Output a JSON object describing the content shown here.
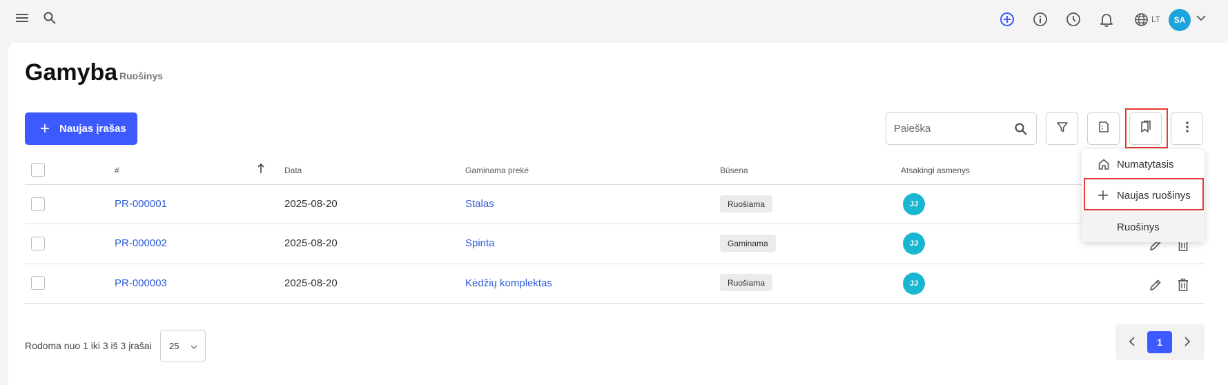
{
  "topbar": {
    "language": "LT",
    "user_initials": "SA"
  },
  "page": {
    "title": "Gamyba",
    "subtitle": "Ruošinys"
  },
  "toolbar": {
    "new_record_label": "Naujas įrašas",
    "search_placeholder": "Paieška"
  },
  "table": {
    "columns": [
      "#",
      "Data",
      "Gaminama prekė",
      "Būsena",
      "Atsakingi asmenys"
    ],
    "rows": [
      {
        "id": "PR-000001",
        "date": "2025-08-20",
        "product": "Stalas",
        "status": "Ruošiama",
        "person": "JJ"
      },
      {
        "id": "PR-000002",
        "date": "2025-08-20",
        "product": "Spinta",
        "status": "Gaminama",
        "person": "JJ"
      },
      {
        "id": "PR-000003",
        "date": "2025-08-20",
        "product": "Kėdžių komplektas",
        "status": "Ruošiama",
        "person": "JJ"
      }
    ]
  },
  "footer": {
    "showing_text": "Rodoma nuo 1 iki 3 iš 3 įrašai",
    "page_size": "25",
    "current_page": "1"
  },
  "views_menu": {
    "items": [
      {
        "label": "Numatytasis",
        "icon": "home-icon"
      },
      {
        "label": "Naujas ruošinys",
        "icon": "plus-icon"
      },
      {
        "label": "Ruošinys",
        "icon": ""
      }
    ]
  },
  "colors": {
    "accent": "#3d5afe",
    "link": "#2e5bd8",
    "highlight": "#e53935",
    "person_avatar": "#1ab6d1"
  }
}
